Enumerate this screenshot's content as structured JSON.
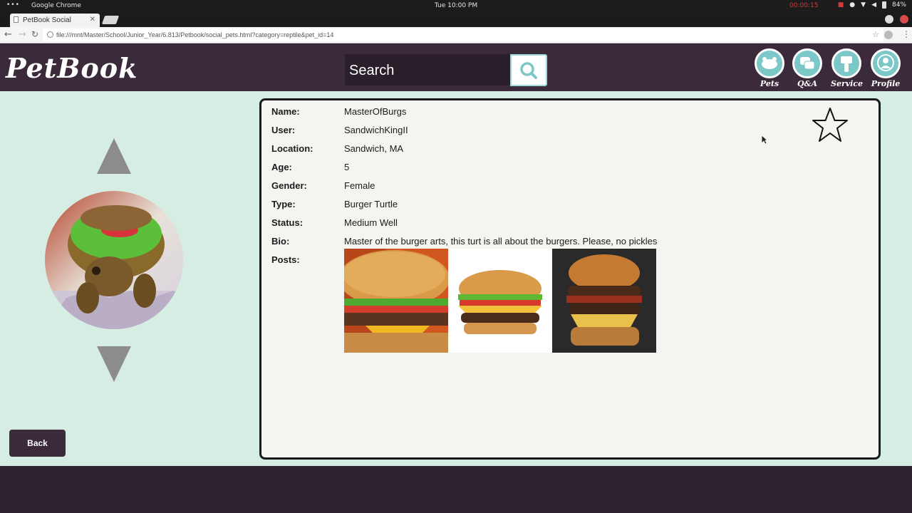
{
  "os": {
    "app_name": "Google Chrome",
    "clock": "Tue 10:00 PM",
    "recording": "00:00:15",
    "battery": "84%"
  },
  "browser": {
    "tab_title": "PetBook Social",
    "url": "file:///mnt/Master/School/Junior_Year/6.813/Petbook/social_pets.html?category=reptile&pet_id=14"
  },
  "header": {
    "logo": "PetBook",
    "search_placeholder": "Search",
    "nav": [
      {
        "label": "Pets",
        "icon": "paw-icon"
      },
      {
        "label": "Q&A",
        "icon": "chat-bubbles-icon"
      },
      {
        "label": "Service",
        "icon": "brush-icon"
      },
      {
        "label": "Profile",
        "icon": "user-icon"
      }
    ]
  },
  "sidebar": {
    "back_label": "Back"
  },
  "profile": {
    "fields": [
      {
        "key": "Name:",
        "value": "MasterOfBurgs"
      },
      {
        "key": "User:",
        "value": "SandwichKingII"
      },
      {
        "key": "Location:",
        "value": "Sandwich, MA"
      },
      {
        "key": "Age:",
        "value": "5"
      },
      {
        "key": "Gender:",
        "value": "Female"
      },
      {
        "key": "Type:",
        "value": "Burger Turtle"
      },
      {
        "key": "Status:",
        "value": "Medium Well"
      },
      {
        "key": "Bio:",
        "value": "Master of the burger arts, this turt is all about the burgers. Please, no pickles"
      }
    ],
    "posts_label": "Posts:",
    "favorite": false
  },
  "colors": {
    "header_bg": "#3a2a3a",
    "content_bg": "#d6ede3",
    "accent_teal": "#7cc7c7",
    "card_bg": "#f4f4f1"
  }
}
